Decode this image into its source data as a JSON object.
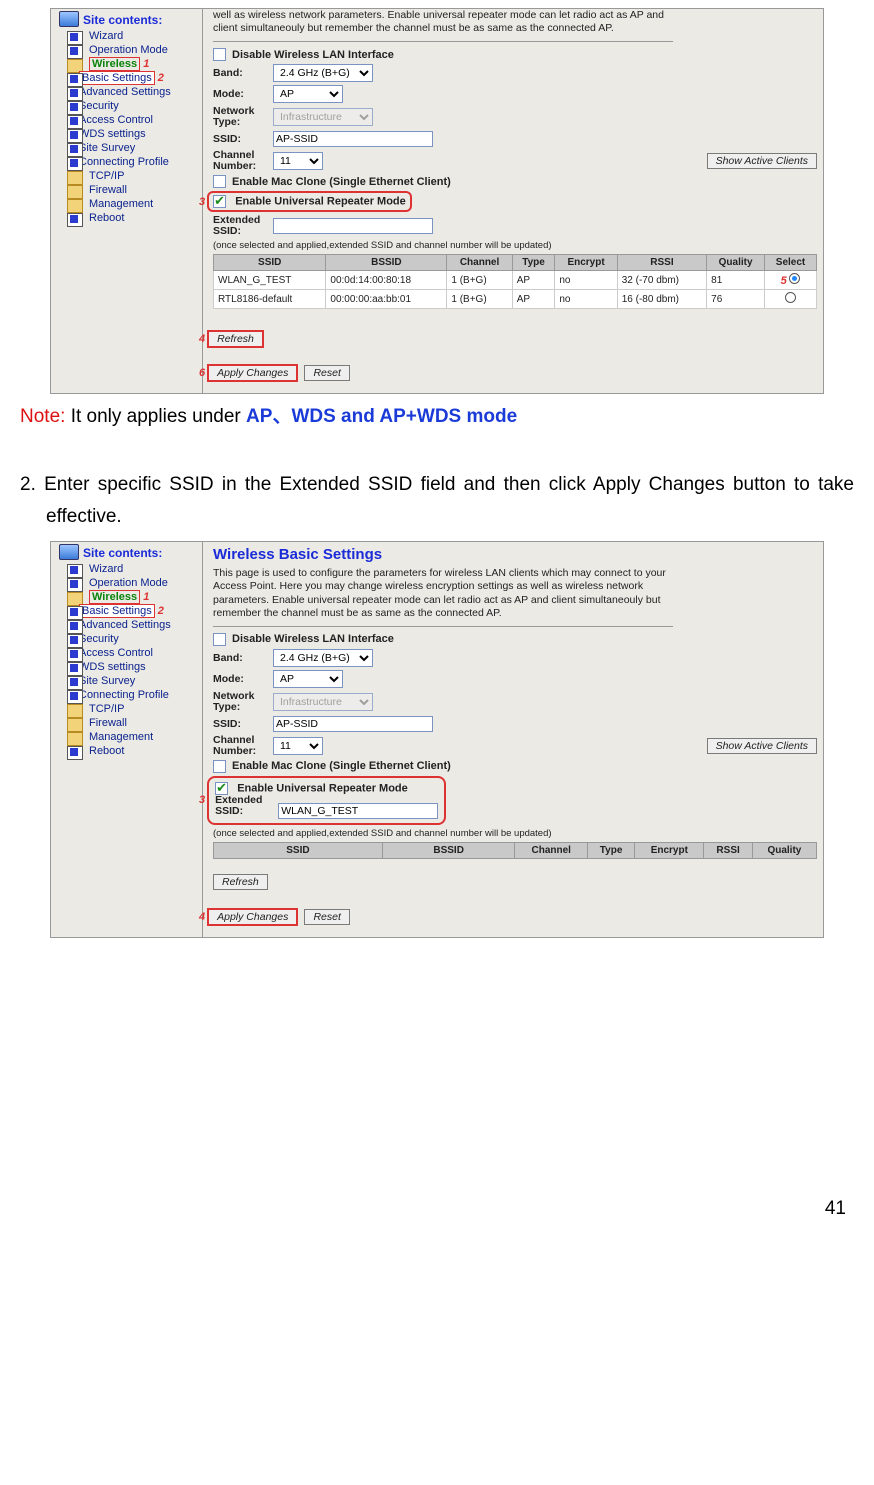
{
  "page_number": "41",
  "note_line": {
    "prefix": "Note: ",
    "mid": "It only applies under ",
    "blue": "AP、WDS and AP+WDS mode"
  },
  "step2": "2.  Enter specific SSID in the Extended SSID field and then click Apply Changes button to take effective.",
  "shot1": {
    "sidebar_title": "Site contents:",
    "markers": {
      "m1": "1",
      "m2": "2",
      "m3": "3",
      "m4": "4",
      "m5": "5",
      "m6": "6"
    },
    "tree": {
      "wizard": "Wizard",
      "opmode": "Operation Mode",
      "wireless": "Wireless",
      "basic": "Basic Settings",
      "advanced": "Advanced Settings",
      "security": "Security",
      "access": "Access Control",
      "wds": "WDS settings",
      "survey": "Site Survey",
      "profile": "Connecting Profile",
      "tcpip": "TCP/IP",
      "firewall": "Firewall",
      "mgmt": "Management",
      "reboot": "Reboot"
    },
    "desc_top": "well as wireless network parameters. Enable universal repeater mode can let radio act as AP and client simultaneouly but remember the channel must be as same as the connected AP.",
    "disable_lan": "Disable Wireless LAN Interface",
    "band_label": "Band:",
    "band_value": "2.4 GHz (B+G)",
    "mode_label": "Mode:",
    "mode_value": "AP",
    "nettype_label": "Network Type:",
    "nettype_value": "Infrastructure",
    "ssid_label": "SSID:",
    "ssid_value": "AP-SSID",
    "chan_label": "Channel Number:",
    "chan_value": "11",
    "show_clients": "Show Active Clients",
    "mac_clone": "Enable Mac Clone (Single Ethernet Client)",
    "repeater": "Enable Universal Repeater Mode",
    "ext_ssid_label": "Extended SSID:",
    "ext_ssid_value": "",
    "hint": "(once selected and applied,extended SSID and channel number will be updated)",
    "table": {
      "headers": {
        "ssid": "SSID",
        "bssid": "BSSID",
        "ch": "Channel",
        "type": "Type",
        "enc": "Encrypt",
        "rssi": "RSSI",
        "q": "Quality",
        "sel": "Select"
      },
      "rows": [
        {
          "ssid": "WLAN_G_TEST",
          "bssid": "00:0d:14:00:80:18",
          "ch": "1 (B+G)",
          "type": "AP",
          "enc": "no",
          "rssi": "32 (-70 dbm)",
          "q": "81",
          "sel": true
        },
        {
          "ssid": "RTL8186-default",
          "bssid": "00:00:00:aa:bb:01",
          "ch": "1 (B+G)",
          "type": "AP",
          "enc": "no",
          "rssi": "16 (-80 dbm)",
          "q": "76",
          "sel": false
        }
      ]
    },
    "refresh": "Refresh",
    "apply": "Apply Changes",
    "reset": "Reset"
  },
  "shot2": {
    "sidebar_title": "Site contents:",
    "markers": {
      "m1": "1",
      "m2": "2",
      "m3": "3",
      "m4": "4"
    },
    "heading": "Wireless Basic Settings",
    "desc": "This page is used to configure the parameters for wireless LAN clients which may connect to your Access Point. Here you may change wireless encryption settings as well as wireless network parameters. Enable universal repeater mode can let radio act as AP and client simultaneouly but remember the channel must be as same as the connected AP.",
    "tree": {
      "wizard": "Wizard",
      "opmode": "Operation Mode",
      "wireless": "Wireless",
      "basic": "Basic Settings",
      "advanced": "Advanced Settings",
      "security": "Security",
      "access": "Access Control",
      "wds": "WDS settings",
      "survey": "Site Survey",
      "profile": "Connecting Profile",
      "tcpip": "TCP/IP",
      "firewall": "Firewall",
      "mgmt": "Management",
      "reboot": "Reboot"
    },
    "disable_lan": "Disable Wireless LAN Interface",
    "band_label": "Band:",
    "band_value": "2.4 GHz (B+G)",
    "mode_label": "Mode:",
    "mode_value": "AP",
    "nettype_label": "Network Type:",
    "nettype_value": "Infrastructure",
    "ssid_label": "SSID:",
    "ssid_value": "AP-SSID",
    "chan_label": "Channel Number:",
    "chan_value": "11",
    "show_clients": "Show Active Clients",
    "mac_clone": "Enable Mac Clone (Single Ethernet Client)",
    "repeater": "Enable Universal Repeater Mode",
    "ext_ssid_label": "Extended SSID:",
    "ext_ssid_value": "WLAN_G_TEST",
    "hint": "(once selected and applied,extended SSID and channel number will be updated)",
    "table_headers": {
      "ssid": "SSID",
      "bssid": "BSSID",
      "ch": "Channel",
      "type": "Type",
      "enc": "Encrypt",
      "rssi": "RSSI",
      "q": "Quality"
    },
    "refresh": "Refresh",
    "apply": "Apply Changes",
    "reset": "Reset"
  }
}
